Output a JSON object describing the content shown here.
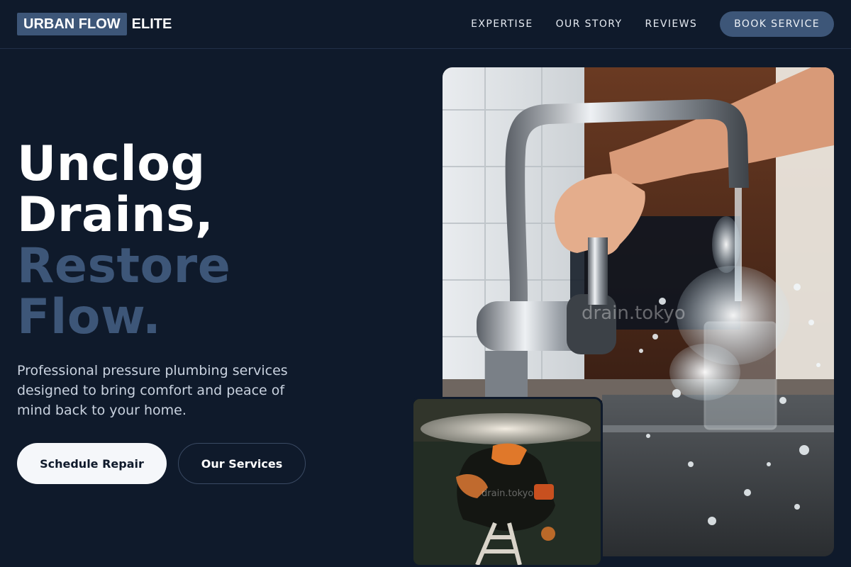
{
  "brand": {
    "highlight": "URBAN FLOW",
    "tail": "ELITE"
  },
  "nav": {
    "links": [
      "EXPERTISE",
      "OUR STORY",
      "REVIEWS"
    ],
    "cta": "BOOK SERVICE"
  },
  "hero": {
    "title_line1": "Unclog",
    "title_line2": "Drains,",
    "title_line3": "Restore",
    "title_line4": "Flow.",
    "subtitle": "Professional pressure plumbing services designed to bring comfort and peace of mind back to your home.",
    "primary_button": "Schedule Repair",
    "secondary_button": "Our Services"
  },
  "images": {
    "main_watermark": "drain.tokyo",
    "small_watermark": "drain.tokyo"
  },
  "colors": {
    "background": "#0f1a2b",
    "accent": "#3d5678",
    "text": "#ffffff",
    "subtext": "#c9d2df"
  }
}
